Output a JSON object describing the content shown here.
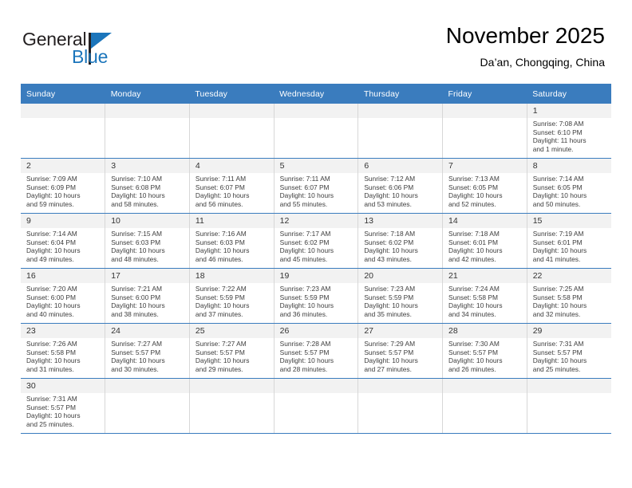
{
  "brand": {
    "name_part1": "General",
    "name_part2": "Blue",
    "accent_color": "#1b75bb"
  },
  "header": {
    "title": "November 2025",
    "subtitle": "Da’an, Chongqing, China"
  },
  "calendar": {
    "header_bg": "#3a7cbe",
    "weekdays": [
      "Sunday",
      "Monday",
      "Tuesday",
      "Wednesday",
      "Thursday",
      "Friday",
      "Saturday"
    ],
    "weeks": [
      [
        {
          "day": "",
          "lines": []
        },
        {
          "day": "",
          "lines": []
        },
        {
          "day": "",
          "lines": []
        },
        {
          "day": "",
          "lines": []
        },
        {
          "day": "",
          "lines": []
        },
        {
          "day": "",
          "lines": []
        },
        {
          "day": "1",
          "lines": [
            "Sunrise: 7:08 AM",
            "Sunset: 6:10 PM",
            "Daylight: 11 hours",
            "and 1 minute."
          ]
        }
      ],
      [
        {
          "day": "2",
          "lines": [
            "Sunrise: 7:09 AM",
            "Sunset: 6:09 PM",
            "Daylight: 10 hours",
            "and 59 minutes."
          ]
        },
        {
          "day": "3",
          "lines": [
            "Sunrise: 7:10 AM",
            "Sunset: 6:08 PM",
            "Daylight: 10 hours",
            "and 58 minutes."
          ]
        },
        {
          "day": "4",
          "lines": [
            "Sunrise: 7:11 AM",
            "Sunset: 6:07 PM",
            "Daylight: 10 hours",
            "and 56 minutes."
          ]
        },
        {
          "day": "5",
          "lines": [
            "Sunrise: 7:11 AM",
            "Sunset: 6:07 PM",
            "Daylight: 10 hours",
            "and 55 minutes."
          ]
        },
        {
          "day": "6",
          "lines": [
            "Sunrise: 7:12 AM",
            "Sunset: 6:06 PM",
            "Daylight: 10 hours",
            "and 53 minutes."
          ]
        },
        {
          "day": "7",
          "lines": [
            "Sunrise: 7:13 AM",
            "Sunset: 6:05 PM",
            "Daylight: 10 hours",
            "and 52 minutes."
          ]
        },
        {
          "day": "8",
          "lines": [
            "Sunrise: 7:14 AM",
            "Sunset: 6:05 PM",
            "Daylight: 10 hours",
            "and 50 minutes."
          ]
        }
      ],
      [
        {
          "day": "9",
          "lines": [
            "Sunrise: 7:14 AM",
            "Sunset: 6:04 PM",
            "Daylight: 10 hours",
            "and 49 minutes."
          ]
        },
        {
          "day": "10",
          "lines": [
            "Sunrise: 7:15 AM",
            "Sunset: 6:03 PM",
            "Daylight: 10 hours",
            "and 48 minutes."
          ]
        },
        {
          "day": "11",
          "lines": [
            "Sunrise: 7:16 AM",
            "Sunset: 6:03 PM",
            "Daylight: 10 hours",
            "and 46 minutes."
          ]
        },
        {
          "day": "12",
          "lines": [
            "Sunrise: 7:17 AM",
            "Sunset: 6:02 PM",
            "Daylight: 10 hours",
            "and 45 minutes."
          ]
        },
        {
          "day": "13",
          "lines": [
            "Sunrise: 7:18 AM",
            "Sunset: 6:02 PM",
            "Daylight: 10 hours",
            "and 43 minutes."
          ]
        },
        {
          "day": "14",
          "lines": [
            "Sunrise: 7:18 AM",
            "Sunset: 6:01 PM",
            "Daylight: 10 hours",
            "and 42 minutes."
          ]
        },
        {
          "day": "15",
          "lines": [
            "Sunrise: 7:19 AM",
            "Sunset: 6:01 PM",
            "Daylight: 10 hours",
            "and 41 minutes."
          ]
        }
      ],
      [
        {
          "day": "16",
          "lines": [
            "Sunrise: 7:20 AM",
            "Sunset: 6:00 PM",
            "Daylight: 10 hours",
            "and 40 minutes."
          ]
        },
        {
          "day": "17",
          "lines": [
            "Sunrise: 7:21 AM",
            "Sunset: 6:00 PM",
            "Daylight: 10 hours",
            "and 38 minutes."
          ]
        },
        {
          "day": "18",
          "lines": [
            "Sunrise: 7:22 AM",
            "Sunset: 5:59 PM",
            "Daylight: 10 hours",
            "and 37 minutes."
          ]
        },
        {
          "day": "19",
          "lines": [
            "Sunrise: 7:23 AM",
            "Sunset: 5:59 PM",
            "Daylight: 10 hours",
            "and 36 minutes."
          ]
        },
        {
          "day": "20",
          "lines": [
            "Sunrise: 7:23 AM",
            "Sunset: 5:59 PM",
            "Daylight: 10 hours",
            "and 35 minutes."
          ]
        },
        {
          "day": "21",
          "lines": [
            "Sunrise: 7:24 AM",
            "Sunset: 5:58 PM",
            "Daylight: 10 hours",
            "and 34 minutes."
          ]
        },
        {
          "day": "22",
          "lines": [
            "Sunrise: 7:25 AM",
            "Sunset: 5:58 PM",
            "Daylight: 10 hours",
            "and 32 minutes."
          ]
        }
      ],
      [
        {
          "day": "23",
          "lines": [
            "Sunrise: 7:26 AM",
            "Sunset: 5:58 PM",
            "Daylight: 10 hours",
            "and 31 minutes."
          ]
        },
        {
          "day": "24",
          "lines": [
            "Sunrise: 7:27 AM",
            "Sunset: 5:57 PM",
            "Daylight: 10 hours",
            "and 30 minutes."
          ]
        },
        {
          "day": "25",
          "lines": [
            "Sunrise: 7:27 AM",
            "Sunset: 5:57 PM",
            "Daylight: 10 hours",
            "and 29 minutes."
          ]
        },
        {
          "day": "26",
          "lines": [
            "Sunrise: 7:28 AM",
            "Sunset: 5:57 PM",
            "Daylight: 10 hours",
            "and 28 minutes."
          ]
        },
        {
          "day": "27",
          "lines": [
            "Sunrise: 7:29 AM",
            "Sunset: 5:57 PM",
            "Daylight: 10 hours",
            "and 27 minutes."
          ]
        },
        {
          "day": "28",
          "lines": [
            "Sunrise: 7:30 AM",
            "Sunset: 5:57 PM",
            "Daylight: 10 hours",
            "and 26 minutes."
          ]
        },
        {
          "day": "29",
          "lines": [
            "Sunrise: 7:31 AM",
            "Sunset: 5:57 PM",
            "Daylight: 10 hours",
            "and 25 minutes."
          ]
        }
      ],
      [
        {
          "day": "30",
          "lines": [
            "Sunrise: 7:31 AM",
            "Sunset: 5:57 PM",
            "Daylight: 10 hours",
            "and 25 minutes."
          ]
        },
        {
          "day": "",
          "lines": []
        },
        {
          "day": "",
          "lines": []
        },
        {
          "day": "",
          "lines": []
        },
        {
          "day": "",
          "lines": []
        },
        {
          "day": "",
          "lines": []
        },
        {
          "day": "",
          "lines": []
        }
      ]
    ]
  }
}
